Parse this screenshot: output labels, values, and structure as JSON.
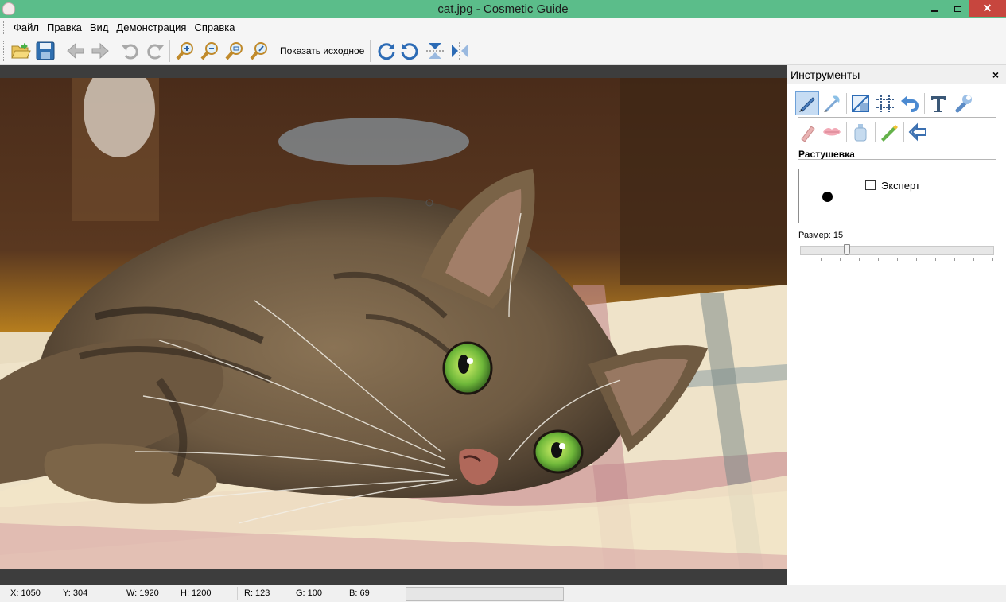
{
  "window": {
    "title": "cat.jpg - Cosmetic Guide",
    "close_glyph": "✕"
  },
  "menu": {
    "items": [
      "Файл",
      "Правка",
      "Вид",
      "Демонстрация",
      "Справка"
    ]
  },
  "toolbar": {
    "show_original_label": "Показать исходное",
    "buttons": [
      "open-folder-icon",
      "save-icon",
      "back-arrow-icon",
      "forward-arrow-icon",
      "undo-icon",
      "redo-icon",
      "zoom-in-icon",
      "zoom-out-icon",
      "zoom-fit-icon",
      "zoom-actual-icon",
      "rotate-clockwise-icon",
      "rotate-counterclockwise-icon",
      "flip-vertical-icon",
      "flip-horizontal-icon"
    ]
  },
  "canvas": {
    "image_name": "cat.jpg"
  },
  "panel": {
    "title": "Инструменты",
    "close_glyph": "×",
    "section_title": "Растушевка",
    "expert_label": "Эксперт",
    "expert_checked": false,
    "size_label": "Размер: 15",
    "size_value": 15,
    "size_fraction": 0.23,
    "row1_tools": [
      "brush-icon",
      "feather-brush-icon",
      "crop-icon",
      "grid-icon",
      "undo-icon",
      "text-icon",
      "wrench-icon"
    ],
    "row2_tools": [
      "pencil-icon",
      "lips-icon",
      "bottle-icon",
      "highlighter-icon",
      "back-icon"
    ]
  },
  "status": {
    "x": "X: 1050",
    "y": "Y: 304",
    "w": "W: 1920",
    "h": "H: 1200",
    "r": "R: 123",
    "g": "G: 100",
    "b": "B: 69"
  },
  "colors": {
    "titlebar": "#5bbd8a",
    "close_button": "#c7463e",
    "canvas_bg": "#3d3d3d",
    "tool_active": "#c6dcf3"
  }
}
